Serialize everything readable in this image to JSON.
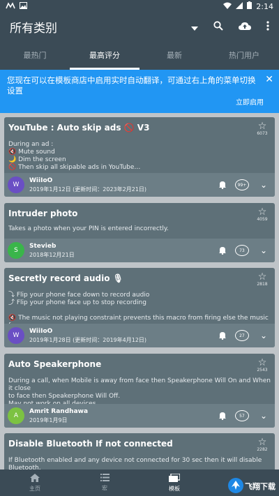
{
  "status": {
    "time": "2:14"
  },
  "app": {
    "title": "所有类别"
  },
  "tabs": [
    "最热门",
    "最高评分",
    "最新",
    "热门用户"
  ],
  "banner": {
    "message": "您现在可以在模板商店中启用实时自动翻译，可通过右上角的菜单切换设置",
    "action": "立即启用"
  },
  "cards": [
    {
      "title": "YouTube : Auto skip ads 🚫 V3",
      "description": [
        "During an ad :",
        "🔇 Mute sound",
        "🌙 Dim the screen",
        "🚫 Then skip all skipable ads in YouTube…"
      ],
      "stars": "6073",
      "avatar_letter": "W",
      "avatar_color": "#6a4fc4",
      "author": "WiiIoO",
      "date": "2019年1月12日  (更新时间：2023年2月21日)",
      "comments": "99+"
    },
    {
      "title": "Intruder photo",
      "description": [
        "Takes a photo when your PIN is entered incorrectly."
      ],
      "stars": "4059",
      "avatar_letter": "S",
      "avatar_color": "#3ab54a",
      "author": "Stevieb",
      "date": "2018年12月21日",
      "comments": "73"
    },
    {
      "title": "Secretly record audio 🎙",
      "description": [
        "⤵ Flip your phone face down to record audio",
        "⤴ Flip your phone face up to stop recording",
        "",
        "🔇 The music not playing constraint prevents this macro from firing else the music from"
      ],
      "stars": "2818",
      "avatar_letter": "W",
      "avatar_color": "#6a4fc4",
      "author": "WiiIoO",
      "date": "2019年1月28日  (更新时间：2019年4月12日)",
      "comments": "27"
    },
    {
      "title": "Auto Speakerphone",
      "description": [
        "During a call, when Mobile is away from face then Speakerphone Will On and When it close",
        "to face then Speakerphone Will Off.",
        "May not work on all devices."
      ],
      "stars": "2543",
      "avatar_letter": "A",
      "avatar_color": "#7cc242",
      "author": "Amrit Randhawa",
      "date": "2019年1月9日",
      "comments": "57"
    },
    {
      "title": "Disable Bluetooth If not connected",
      "description": [
        "If Bluetooth enabled and any device not connected for 30 sec then it will disable Bluetooth."
      ],
      "stars": "2282"
    }
  ],
  "bottom_nav": [
    {
      "label": "主页",
      "icon": "home-icon"
    },
    {
      "label": "宏",
      "icon": "list-icon"
    },
    {
      "label": "模板",
      "icon": "templates-icon"
    },
    {
      "label": "",
      "icon": "more-icon"
    }
  ],
  "watermark": "飞翔下载"
}
